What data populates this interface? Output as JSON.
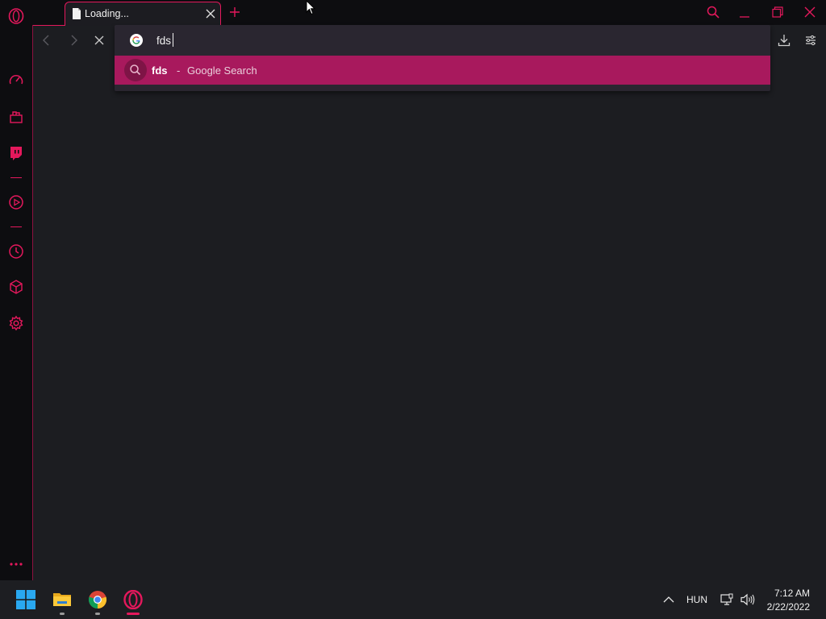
{
  "colors": {
    "accent": "#e4185c",
    "suggestion_highlight": "#a8195d",
    "content_bg": "#1c1d21",
    "chrome_bg": "#0d0d10",
    "taskbar_bg": "#1d1e22"
  },
  "tab": {
    "title": "Loading...",
    "icon": "document-icon",
    "close_icon": "close-icon"
  },
  "new_tab_icon": "plus-icon",
  "window_controls": [
    "search-icon",
    "minimize-icon",
    "restore-icon",
    "close-icon"
  ],
  "toolbar": {
    "nav_icons": [
      "back-arrow-icon",
      "forward-arrow-icon",
      "stop-loading-icon"
    ],
    "right_icons": [
      "download-icon",
      "easy-setup-icon"
    ]
  },
  "address_bar": {
    "value": "fds",
    "engine_icon": "google-icon"
  },
  "suggestion": {
    "query": "fds",
    "separator": "-",
    "description": "Google Search",
    "icon": "search-icon"
  },
  "sidebar": {
    "items": [
      "opera-logo-icon",
      "speed-dial-icon",
      "extensions-icon",
      "twitch-icon",
      "player-icon",
      "history-icon",
      "cube-icon",
      "settings-icon",
      "more-icon"
    ]
  },
  "taskbar": {
    "apps": [
      "windows-start-icon",
      "file-explorer-icon",
      "chrome-icon",
      "opera-gx-icon"
    ],
    "tray_icons": [
      "chevron-up-icon",
      "network-icon",
      "volume-icon"
    ],
    "language": "HUN",
    "time": "7:12 AM",
    "date": "2/22/2022"
  }
}
